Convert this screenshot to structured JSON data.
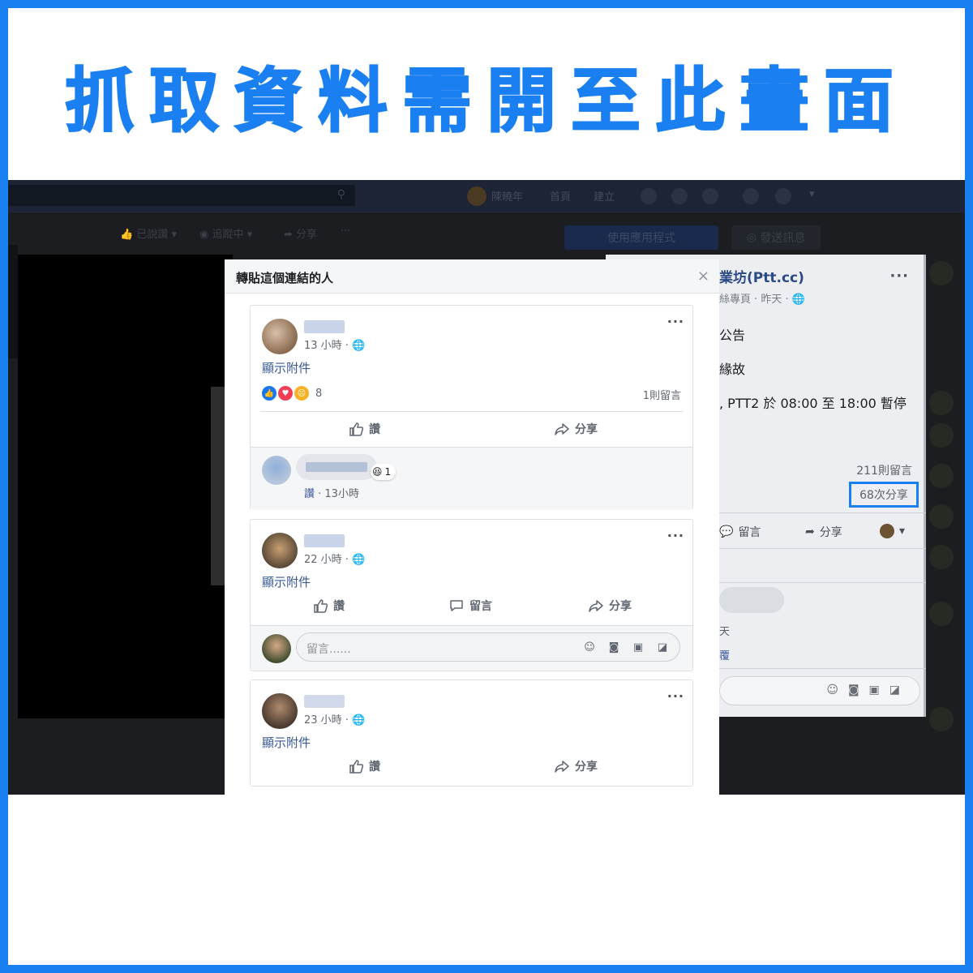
{
  "banner": {
    "title": "抓取資料需開至此畫面",
    "color": "#1a7ff0"
  },
  "background_page": {
    "nav": {
      "user_name": "陳曉年",
      "home": "首頁",
      "create": "建立"
    },
    "subbar": {
      "liked": "已說讚",
      "following": "追蹤中",
      "share": "分享",
      "more": "···",
      "use_app": "使用應用程式",
      "send_message": "發送訊息"
    },
    "post": {
      "page_name": "業坊(Ptt.cc)",
      "meta": "絲專頁 · 昨天 ·",
      "line1": "公告",
      "line2": "緣故",
      "line3": ", PTT2 於 08:00 至 18:00 暫停",
      "comment_count": "211則留言",
      "share_count": "68次分享",
      "actions": {
        "comment": "留言",
        "share": "分享"
      },
      "comment_meta": "天",
      "reply": "覆"
    }
  },
  "modal": {
    "title": "轉貼這個連結的人",
    "close": "×",
    "more": "···",
    "posts": [
      {
        "time": "13 小時 ·",
        "attachment_link": "顯示附件",
        "reaction_count": "8",
        "comment_count": "1則留言",
        "actions": {
          "like": "讚",
          "share": "分享"
        },
        "comment": {
          "reaction_count": "1",
          "like_link": "讚",
          "time": " · 13小時"
        }
      },
      {
        "time": "22 小時 ·",
        "attachment_link": "顯示附件",
        "actions": {
          "like": "讚",
          "comment": "留言",
          "share": "分享"
        },
        "comment_placeholder": "留言......"
      },
      {
        "time": "23 小時 ·",
        "attachment_link": "顯示附件",
        "actions": {
          "like": "讚",
          "share": "分享"
        }
      }
    ]
  },
  "colors": {
    "facebook_link": "#385898",
    "highlight_border": "#1a7ff0"
  }
}
